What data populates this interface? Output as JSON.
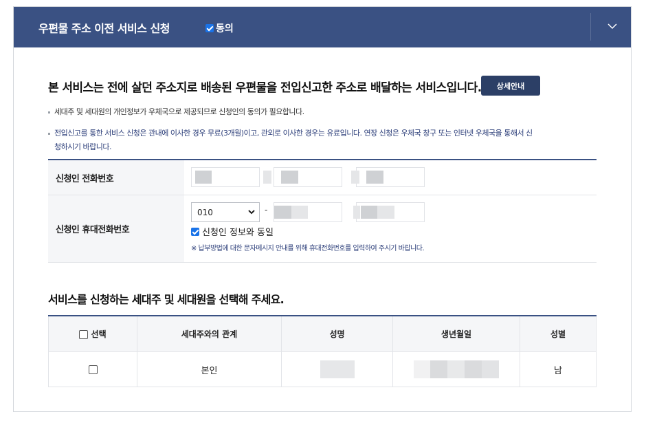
{
  "header": {
    "title": "우편물 주소 이전 서비스 신청",
    "agree_label": "동의",
    "agree_checked": true
  },
  "intro": {
    "text": "본 서비스는 전에 살던 주소지로 배송된 우편물을 전입신고한 주소로 배달하는 서비스입니다.",
    "detail_button": "상세안내"
  },
  "notes": [
    "세대주 및 세대원의 개인정보가 우체국으로 제공되므로 신청인의 동의가 필요합니다.",
    "전입신고를 통한 서비스 신청은 관내에 이사한 경우 무료(3개월)이고, 관외로 이사한 경우는 유료입니다. 연장 신청은 우체국 창구 또는 인터넷 우체국을 통해서 신",
    "청하시기 바랍니다."
  ],
  "form": {
    "phone_label": "신청인 전화번호",
    "mobile_label": "신청인 휴대전화번호",
    "mobile_prefix": "010",
    "dash": "-",
    "same_as_applicant": "신청인 정보와 동일",
    "same_checked": true,
    "hint": "※ 납부방법에 대한 문자메시지 안내를 위해 휴대전화번호를 입력하여 주시기 바랍니다."
  },
  "members": {
    "section_title": "서비스를 신청하는 세대주 및 세대원을 선택해 주세요.",
    "columns": [
      "선택",
      "세대주와의 관계",
      "성명",
      "생년월일",
      "성별"
    ],
    "rows": [
      {
        "relation": "본인",
        "gender": "남"
      }
    ]
  },
  "colors": {
    "header_bg": "#3a5183",
    "button_bg": "#2c3f66",
    "accent_blue": "#2d3f7a"
  },
  "icons": {
    "expand": "chevron-down-icon",
    "select_caret": "caret-down-icon"
  }
}
